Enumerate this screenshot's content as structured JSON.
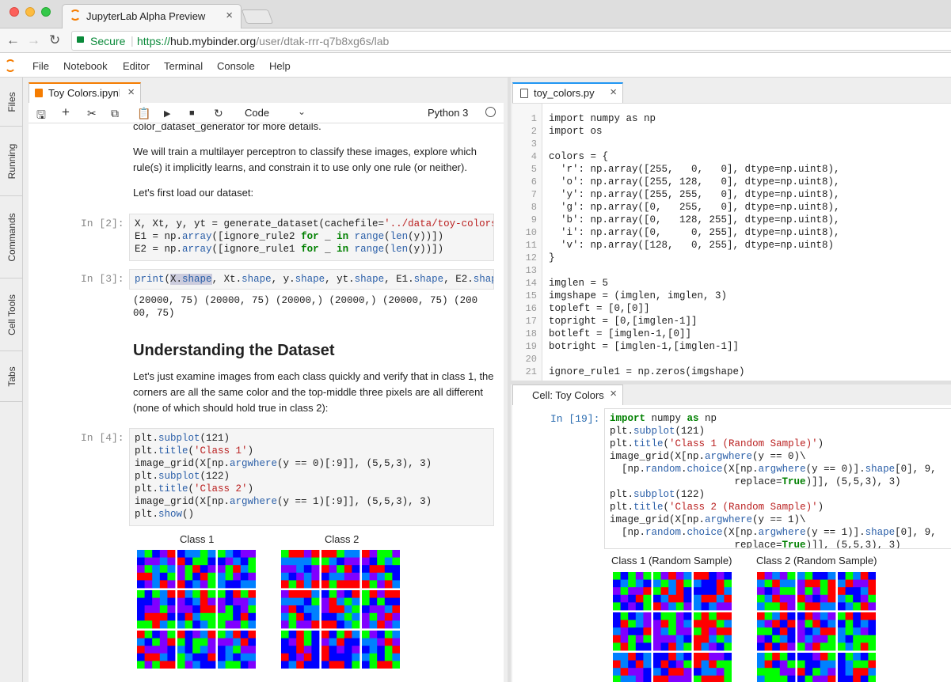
{
  "browser": {
    "tab_title": "JupyterLab Alpha Preview",
    "secure_label": "Secure",
    "url_scheme": "https://",
    "url_host": "hub.mybinder.org",
    "url_path": "/user/dtak-rrr-q7b8xg6s/lab"
  },
  "menubar": {
    "items": [
      "File",
      "Notebook",
      "Editor",
      "Terminal",
      "Console",
      "Help"
    ]
  },
  "sidebar": {
    "tabs": [
      "Files",
      "Running",
      "Commands",
      "Cell Tools",
      "Tabs"
    ]
  },
  "notebook": {
    "tab_title": "Toy Colors.ipynb",
    "cell_type": "Code",
    "kernel": "Python 3",
    "md1": "color_dataset_generator for more details.",
    "md2": "We will train a multilayer perceptron to classify these images, explore which rule(s) it implicitly learns, and constrain it to use only one rule (or neither).",
    "md3": "Let's first load our dataset:",
    "prompt2": "In [2]:",
    "prompt3": "In [3]:",
    "prompt4": "In [4]:",
    "out3_line1": "(20000, 75) (20000, 75) (20000,) (20000,) (20000, 75) (200",
    "out3_line2": "00, 75)",
    "heading": "Understanding the Dataset",
    "md4": "Let's just examine images from each class quickly and verify that in class 1, the corners are all the same color and the top-middle three pixels are all different (none of which should hold true in class 2):",
    "plot_title_1": "Class 1",
    "plot_title_2": "Class 2"
  },
  "editor": {
    "tab_title": "toy_colors.py",
    "line_numbers": [
      "1",
      "2",
      "3",
      "4",
      "5",
      "6",
      "7",
      "8",
      "9",
      "10",
      "11",
      "12",
      "13",
      "14",
      "15",
      "16",
      "17",
      "18",
      "19",
      "20",
      "21"
    ],
    "lines": [
      "import numpy as np",
      "import os",
      "",
      "colors = {",
      "  'r': np.array([255,   0,   0], dtype=np.uint8),",
      "  'o': np.array([255, 128,   0], dtype=np.uint8),",
      "  'y': np.array([255, 255,   0], dtype=np.uint8),",
      "  'g': np.array([0,   255,   0], dtype=np.uint8),",
      "  'b': np.array([0,   128, 255], dtype=np.uint8),",
      "  'i': np.array([0,     0, 255], dtype=np.uint8),",
      "  'v': np.array([128,   0, 255], dtype=np.uint8)",
      "}",
      "",
      "imglen = 5",
      "imgshape = (imglen, imglen, 3)",
      "topleft = [0,[0]]",
      "topright = [0,[imglen-1]]",
      "botleft = [imglen-1,[0]]",
      "botright = [imglen-1,[imglen-1]]",
      "",
      "ignore_rule1 = np.zeros(imgshape)"
    ]
  },
  "cellpanel": {
    "tab_title": "Cell: Toy Colors.ipynb",
    "prompt": "In [19]:",
    "plot_title_1": "Class 1 (Random Sample)",
    "plot_title_2": "Class 2 (Random Sample)"
  },
  "colors": {
    "red": "#ff0000",
    "green": "#00ff00",
    "blue": "#0080ff",
    "violet": "#8000ff",
    "indigo": "#0000ff",
    "accent_orange": "#f57c00",
    "accent_blue": "#2196f3"
  }
}
